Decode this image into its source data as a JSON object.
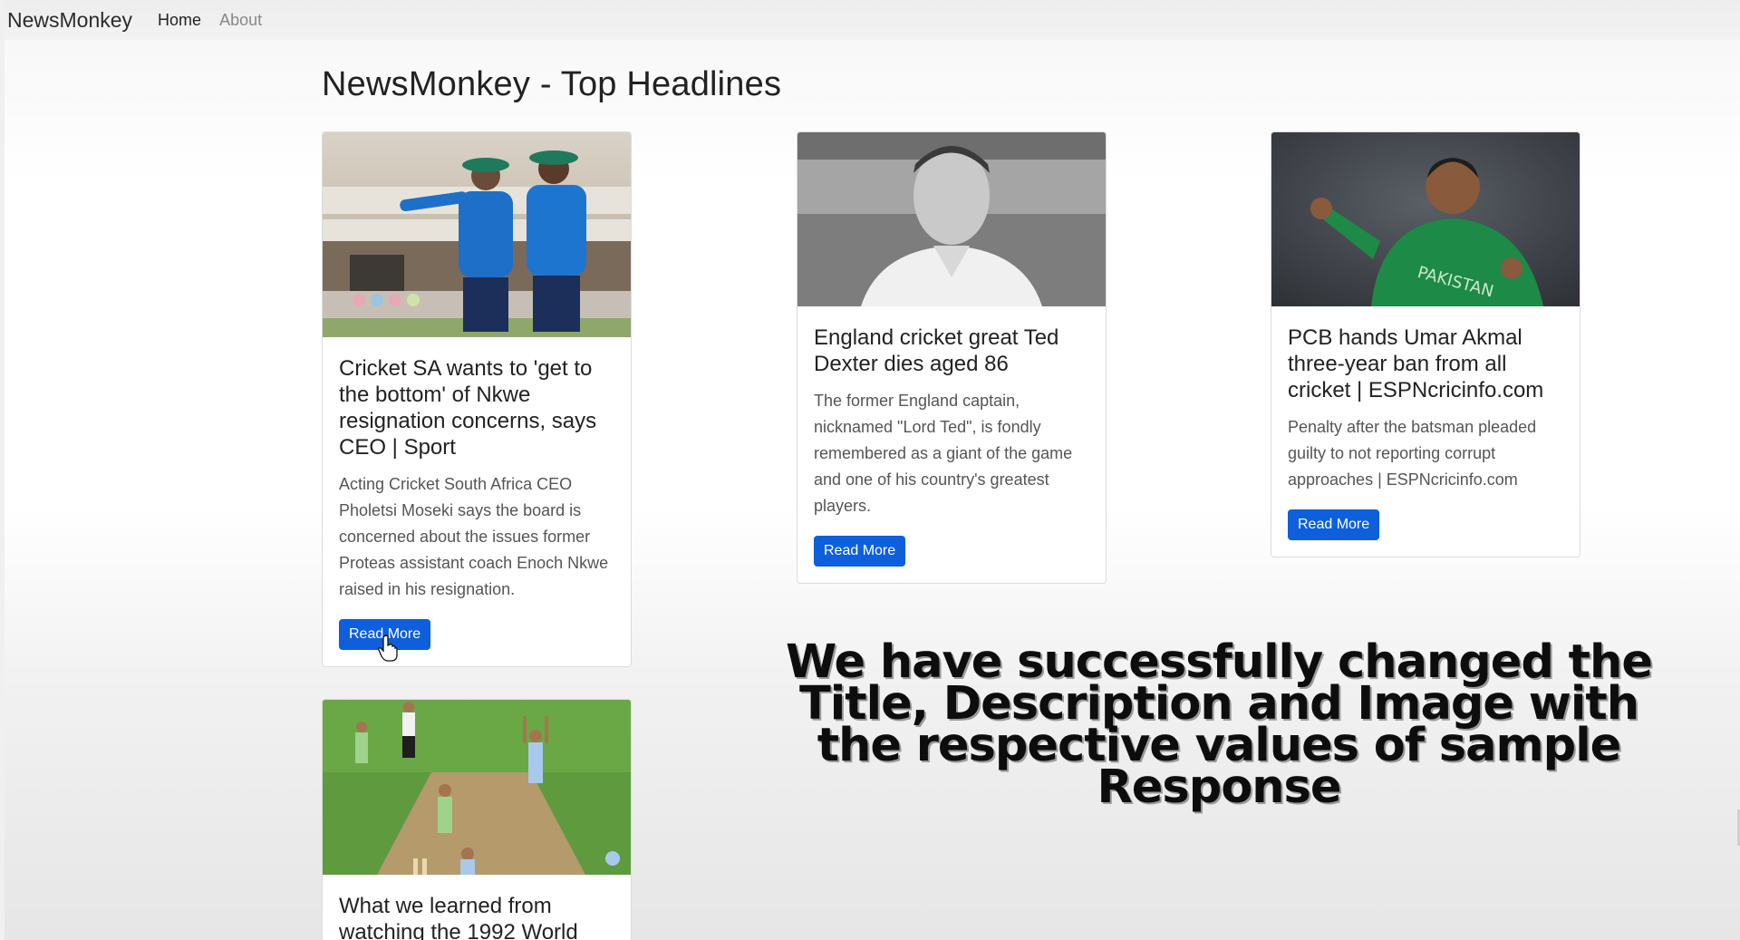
{
  "navbar": {
    "brand": "NewsMonkey",
    "links": [
      {
        "label": "Home"
      },
      {
        "label": "About"
      }
    ]
  },
  "page": {
    "title": "NewsMonkey - Top Headlines"
  },
  "cards": [
    {
      "title": "Cricket SA wants to 'get to the bottom' of Nkwe resignation concerns, says CEO | Sport",
      "description": "Acting Cricket South Africa CEO Pholetsi Moseki says the board is concerned about the issues former Proteas assistant coach Enoch Nkwe raised in his resignation.",
      "button": "Read More"
    },
    {
      "title": "England cricket great Ted Dexter dies aged 86",
      "description": "The former England captain, nicknamed \"Lord Ted\", is fondly remembered as a giant of the game and one of his country's greatest players.",
      "button": "Read More"
    },
    {
      "title": "PCB hands Umar Akmal three-year ban from all cricket | ESPNcricinfo.com",
      "description": "Penalty after the batsman pleaded guilty to not reporting corrupt approaches | ESPNcricinfo.com",
      "button": "Read More"
    },
    {
      "title": "What we learned from watching the 1992 World",
      "description": "",
      "button": ""
    }
  ],
  "overlay_caption": "We have successfully changed the Title, Description and Image with the respective values of sample Response",
  "colors": {
    "button": "#0d5fdc",
    "navbar": "#ededed"
  }
}
